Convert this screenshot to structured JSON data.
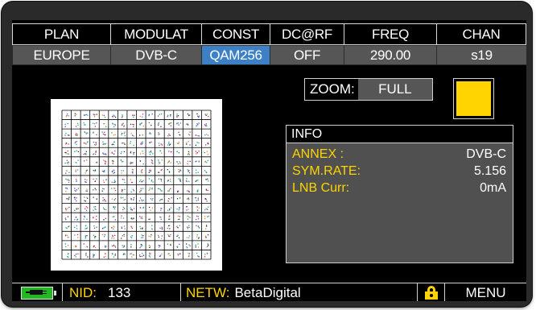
{
  "header": {
    "columns": [
      {
        "label": "PLAN",
        "value": "EUROPE"
      },
      {
        "label": "MODULAT",
        "value": "DVB-C"
      },
      {
        "label": "CONST",
        "value": "QAM256",
        "selected": true
      },
      {
        "label": "DC@RF",
        "value": "OFF"
      },
      {
        "label": "FREQ",
        "value": "290.00"
      },
      {
        "label": "CHAN",
        "value": "s19"
      }
    ]
  },
  "zoom": {
    "label": "ZOOM:",
    "value": "FULL",
    "indicator_color": "#ffd400"
  },
  "info": {
    "title": "INFO",
    "rows": [
      {
        "key": "ANNEX  :",
        "value": "DVB-C"
      },
      {
        "key": "SYM.RATE:",
        "value": "5.156"
      },
      {
        "key": "LNB Curr:",
        "value": "0mA"
      }
    ]
  },
  "status": {
    "battery_icon": "battery-charging-icon",
    "nid_label": "NID:",
    "nid_value": "133",
    "netw_label": "NETW:",
    "netw_value": "BetaDigital",
    "lock_icon": "lock-icon",
    "menu_label": "MENU"
  },
  "constellation": {
    "type": "QAM256 constellation",
    "grid": 16
  },
  "colors": {
    "accent_yellow": "#ffd400",
    "selected_blue": "#3d80c6",
    "cell_gray": "#565656",
    "battery_green": "#22b822"
  }
}
